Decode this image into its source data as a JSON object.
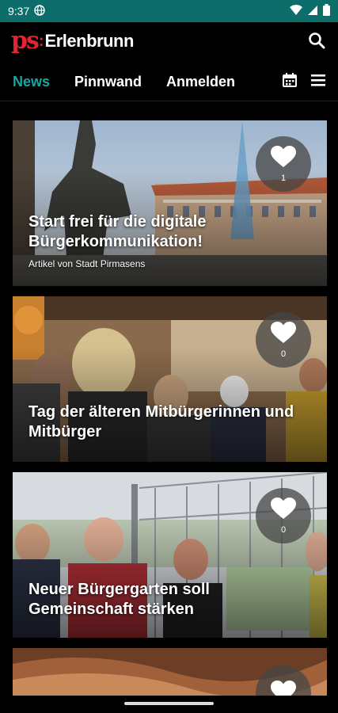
{
  "status": {
    "time": "9:37"
  },
  "app": {
    "logo_mark": "ps",
    "town": "Erlenbrunn"
  },
  "tabs": [
    {
      "label": "News",
      "active": true
    },
    {
      "label": "Pinnwand",
      "active": false
    },
    {
      "label": "Anmelden",
      "active": false
    }
  ],
  "articles": [
    {
      "title": "Start frei für die digitale Bürgerkommunikation!",
      "byline": "Artikel von Stadt Pirmasens",
      "likes": "1"
    },
    {
      "title": "Tag der älteren Mitbürgerinnen und Mitbürger",
      "likes": "0"
    },
    {
      "title": "Neuer Bürgergarten soll Gemeinschaft stärken",
      "likes": "0"
    },
    {
      "title": ""
    }
  ],
  "colors": {
    "status_bar": "#0d6d6b",
    "accent": "#16a7a2",
    "logo_red": "#e0252e"
  }
}
